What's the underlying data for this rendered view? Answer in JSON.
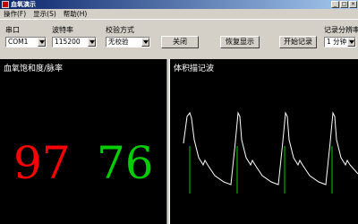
{
  "window": {
    "title": "血氧演示"
  },
  "menu": [
    "操作(F)",
    "显示(S)",
    "帮助(H)"
  ],
  "toolbar": {
    "port": {
      "label": "串口",
      "value": "COM1"
    },
    "baud": {
      "label": "波特率",
      "value": "115200"
    },
    "parity": {
      "label": "校验方式",
      "value": "无校验"
    },
    "close_label": "关闭",
    "restore_label": "恢复显示",
    "start_record_label": "开始记录",
    "record_freq": {
      "label": "记录分辨率",
      "value": "1 分钟"
    }
  },
  "spo2_panel": {
    "title": "血氧饱和度/脉率",
    "spo2": "97",
    "pulse_rate": "76"
  },
  "wave_panel": {
    "title": "体积描记波"
  },
  "colors": {
    "spo2": "#ff0000",
    "pulse": "#00cc00",
    "wave": "#ffffff",
    "beat_marker": "#00cc00"
  }
}
